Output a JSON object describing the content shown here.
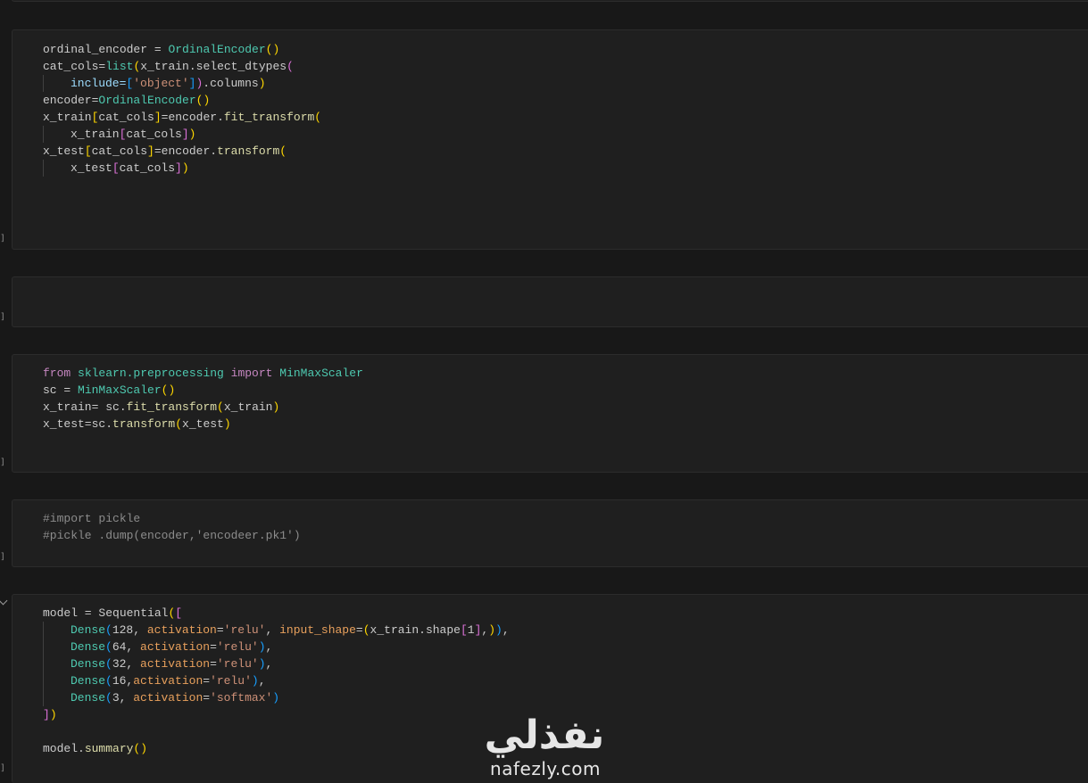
{
  "cells": [
    {
      "id": "cell-ordinal",
      "exec_label": "]",
      "lines": [
        [
          {
            "t": "ordinal_encoder = ",
            "c": "t-plain"
          },
          {
            "t": "OrdinalEncoder",
            "c": "t-cls"
          },
          {
            "t": "()",
            "c": "t-par"
          }
        ],
        [
          {
            "t": "cat_cols=",
            "c": "t-plain"
          },
          {
            "t": "list",
            "c": "t-cls"
          },
          {
            "t": "(",
            "c": "t-par"
          },
          {
            "t": "x_train.",
            "c": "t-plain"
          },
          {
            "t": "select_dtypes",
            "c": "t-plain"
          },
          {
            "t": "(",
            "c": "t-br2"
          }
        ],
        [
          {
            "indent": 1
          },
          {
            "t": "include=",
            "c": "t-prm"
          },
          {
            "t": "[",
            "c": "t-br3"
          },
          {
            "t": "'object'",
            "c": "t-str"
          },
          {
            "t": "]",
            "c": "t-br3"
          },
          {
            "t": ")",
            "c": "t-br2"
          },
          {
            "t": ".columns",
            "c": "t-plain"
          },
          {
            "t": ")",
            "c": "t-par"
          }
        ],
        [
          {
            "t": "encoder=",
            "c": "t-plain"
          },
          {
            "t": "OrdinalEncoder",
            "c": "t-cls"
          },
          {
            "t": "()",
            "c": "t-par"
          }
        ],
        [
          {
            "t": "x_train",
            "c": "t-plain"
          },
          {
            "t": "[",
            "c": "t-par"
          },
          {
            "t": "cat_cols",
            "c": "t-plain"
          },
          {
            "t": "]",
            "c": "t-par"
          },
          {
            "t": "=encoder.",
            "c": "t-plain"
          },
          {
            "t": "fit_transform",
            "c": "t-fn"
          },
          {
            "t": "(",
            "c": "t-par"
          }
        ],
        [
          {
            "indent": 1
          },
          {
            "t": "x_train",
            "c": "t-plain"
          },
          {
            "t": "[",
            "c": "t-br2"
          },
          {
            "t": "cat_cols",
            "c": "t-plain"
          },
          {
            "t": "]",
            "c": "t-br2"
          },
          {
            "t": ")",
            "c": "t-par"
          }
        ],
        [
          {
            "t": "x_test",
            "c": "t-plain"
          },
          {
            "t": "[",
            "c": "t-par"
          },
          {
            "t": "cat_cols",
            "c": "t-plain"
          },
          {
            "t": "]",
            "c": "t-par"
          },
          {
            "t": "=encoder.",
            "c": "t-plain"
          },
          {
            "t": "transform",
            "c": "t-fn"
          },
          {
            "t": "(",
            "c": "t-par"
          }
        ],
        [
          {
            "indent": 1
          },
          {
            "t": "x_test",
            "c": "t-plain"
          },
          {
            "t": "[",
            "c": "t-br2"
          },
          {
            "t": "cat_cols",
            "c": "t-plain"
          },
          {
            "t": "]",
            "c": "t-br2"
          },
          {
            "t": ")",
            "c": "t-par"
          }
        ]
      ]
    },
    {
      "id": "cell-empty",
      "exec_label": "]",
      "lines": []
    },
    {
      "id": "cell-scaler",
      "exec_label": "]",
      "lines": [
        [
          {
            "t": "from ",
            "c": "t-kw"
          },
          {
            "t": "sklearn.preprocessing ",
            "c": "t-cls"
          },
          {
            "t": "import ",
            "c": "t-kw"
          },
          {
            "t": "MinMaxScaler",
            "c": "t-cls"
          }
        ],
        [
          {
            "t": "sc = ",
            "c": "t-plain"
          },
          {
            "t": "MinMaxScaler",
            "c": "t-cls"
          },
          {
            "t": "()",
            "c": "t-par"
          }
        ],
        [
          {
            "t": "x_train= sc.",
            "c": "t-plain"
          },
          {
            "t": "fit_transform",
            "c": "t-fn"
          },
          {
            "t": "(",
            "c": "t-par"
          },
          {
            "t": "x_train",
            "c": "t-plain"
          },
          {
            "t": ")",
            "c": "t-par"
          }
        ],
        [
          {
            "t": "x_test=sc.",
            "c": "t-plain"
          },
          {
            "t": "transform",
            "c": "t-fn"
          },
          {
            "t": "(",
            "c": "t-par"
          },
          {
            "t": "x_test",
            "c": "t-plain"
          },
          {
            "t": ")",
            "c": "t-par"
          }
        ]
      ]
    },
    {
      "id": "cell-pickle",
      "exec_label": "]",
      "lines": [
        [
          {
            "t": "#import pickle",
            "c": "t-com"
          }
        ],
        [
          {
            "t": "#pickle .dump(encoder,'encodeer.pk1')",
            "c": "t-com"
          }
        ]
      ]
    },
    {
      "id": "cell-model",
      "exec_label": "]",
      "lines": [
        [
          {
            "t": "model = ",
            "c": "t-plain"
          },
          {
            "t": "Sequential",
            "c": "t-plain"
          },
          {
            "t": "(",
            "c": "t-par"
          },
          {
            "t": "[",
            "c": "t-br2"
          }
        ],
        [
          {
            "indent": 1
          },
          {
            "t": "Dense",
            "c": "t-cls"
          },
          {
            "t": "(",
            "c": "t-br3"
          },
          {
            "t": "128, ",
            "c": "t-plain"
          },
          {
            "t": "activation",
            "c": "t-act"
          },
          {
            "t": "=",
            "c": "t-plain"
          },
          {
            "t": "'relu'",
            "c": "t-str"
          },
          {
            "t": ", ",
            "c": "t-plain"
          },
          {
            "t": "input_shape",
            "c": "t-act"
          },
          {
            "t": "=",
            "c": "t-plain"
          },
          {
            "t": "(",
            "c": "t-par"
          },
          {
            "t": "x_train.shape",
            "c": "t-plain"
          },
          {
            "t": "[",
            "c": "t-br2"
          },
          {
            "t": "1",
            "c": "t-plain"
          },
          {
            "t": "]",
            "c": "t-br2"
          },
          {
            "t": ",",
            "c": "t-plain"
          },
          {
            "t": ")",
            "c": "t-par"
          },
          {
            "t": ")",
            "c": "t-br3"
          },
          {
            "t": ",",
            "c": "t-plain"
          }
        ],
        [
          {
            "indent": 1
          },
          {
            "t": "Dense",
            "c": "t-cls"
          },
          {
            "t": "(",
            "c": "t-br3"
          },
          {
            "t": "64, ",
            "c": "t-plain"
          },
          {
            "t": "activation",
            "c": "t-act"
          },
          {
            "t": "=",
            "c": "t-plain"
          },
          {
            "t": "'relu'",
            "c": "t-str"
          },
          {
            "t": ")",
            "c": "t-br3"
          },
          {
            "t": ",",
            "c": "t-plain"
          }
        ],
        [
          {
            "indent": 1
          },
          {
            "t": "Dense",
            "c": "t-cls"
          },
          {
            "t": "(",
            "c": "t-br3"
          },
          {
            "t": "32, ",
            "c": "t-plain"
          },
          {
            "t": "activation",
            "c": "t-act"
          },
          {
            "t": "=",
            "c": "t-plain"
          },
          {
            "t": "'relu'",
            "c": "t-str"
          },
          {
            "t": ")",
            "c": "t-br3"
          },
          {
            "t": ",",
            "c": "t-plain"
          }
        ],
        [
          {
            "indent": 1
          },
          {
            "t": "Dense",
            "c": "t-cls"
          },
          {
            "t": "(",
            "c": "t-br3"
          },
          {
            "t": "16,",
            "c": "t-plain"
          },
          {
            "t": "activation",
            "c": "t-act"
          },
          {
            "t": "=",
            "c": "t-plain"
          },
          {
            "t": "'relu'",
            "c": "t-str"
          },
          {
            "t": ")",
            "c": "t-br3"
          },
          {
            "t": ",",
            "c": "t-plain"
          }
        ],
        [
          {
            "indent": 1
          },
          {
            "t": "Dense",
            "c": "t-cls"
          },
          {
            "t": "(",
            "c": "t-br3"
          },
          {
            "t": "3, ",
            "c": "t-plain"
          },
          {
            "t": "activation",
            "c": "t-act"
          },
          {
            "t": "=",
            "c": "t-plain"
          },
          {
            "t": "'softmax'",
            "c": "t-str"
          },
          {
            "t": ")",
            "c": "t-br3"
          }
        ],
        [
          {
            "t": "]",
            "c": "t-br2"
          },
          {
            "t": ")",
            "c": "t-par"
          }
        ],
        [],
        [
          {
            "t": "model.",
            "c": "t-plain"
          },
          {
            "t": "summary",
            "c": "t-fn"
          },
          {
            "t": "()",
            "c": "t-par"
          }
        ]
      ]
    }
  ],
  "watermark": {
    "arabic": "نفذلي",
    "latin": "nafezly.com"
  }
}
